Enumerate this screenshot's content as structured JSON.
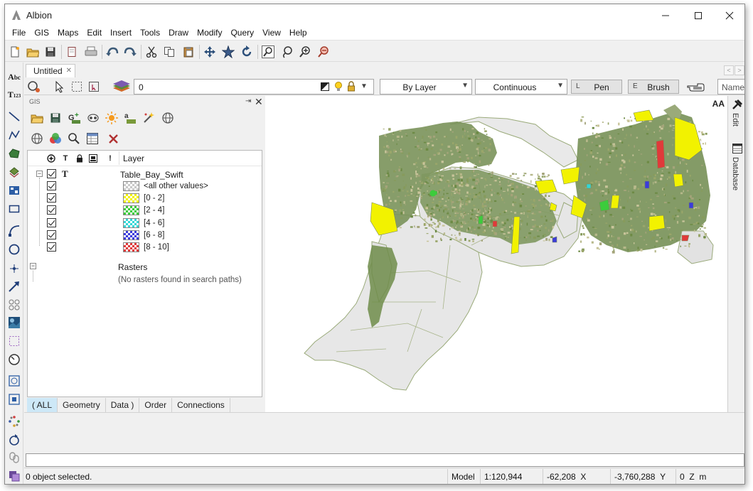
{
  "window": {
    "title": "Albion"
  },
  "menu": [
    "File",
    "GIS",
    "Maps",
    "Edit",
    "Insert",
    "Tools",
    "Draw",
    "Modify",
    "Query",
    "View",
    "Help"
  ],
  "document_tab": {
    "label": "Untitled"
  },
  "style_toolbar": {
    "layer_value": "0",
    "linetype_by": "By Layer",
    "linestyle": "Continuous",
    "pen": {
      "key": "L",
      "label": "Pen"
    },
    "brush": {
      "key": "E",
      "label": "Brush"
    },
    "named": "Named"
  },
  "gis_panel": {
    "title": "GIS",
    "header": {
      "layer": "Layer",
      "text_col": "T",
      "warn_col": "!"
    },
    "table": {
      "name": "Table_Bay_Swift",
      "type_glyph": "T"
    },
    "legend": [
      {
        "label": "<all other values>",
        "color": "#c8c8c8"
      },
      {
        "label": "[0 - 2]",
        "color": "#f2f200"
      },
      {
        "label": "[2 - 4]",
        "color": "#3ccc3c"
      },
      {
        "label": "[4 - 6]",
        "color": "#33d6d6"
      },
      {
        "label": "[6 - 8]",
        "color": "#3b3bdb"
      },
      {
        "label": "[8 - 10]",
        "color": "#e03a3a"
      }
    ],
    "rasters": {
      "label": "Rasters",
      "note": "(No rasters found in search paths)"
    },
    "tabs": [
      "( ALL",
      "Geometry",
      "Data )",
      "Order",
      "Connections"
    ]
  },
  "map": {
    "font_toggle": "AA"
  },
  "right_dock": {
    "edit": "Edit",
    "database": "Database"
  },
  "status": {
    "selection": "0 object selected.",
    "space": "Model",
    "scale": "1:120,944",
    "x_value": "-62,208",
    "x_axis": "X",
    "y_value": "-3,760,288",
    "y_axis": "Y",
    "z_value": "0",
    "z_axis": "Z",
    "unit": "m"
  },
  "icons": {
    "toolbar": [
      "new-icon",
      "open-folder-icon",
      "save-icon",
      "print-preview-icon",
      "print-icon",
      "undo-icon",
      "redo-icon",
      "cut-icon",
      "copy-icon",
      "paste-icon",
      "pan-icon",
      "star-icon",
      "refresh-icon",
      "zoom-window-icon",
      "lasso-icon",
      "zoom-in-icon",
      "zoom-out-icon"
    ],
    "left": [
      "text-icon",
      "attribute-text-icon",
      "line-icon",
      "polyline-icon",
      "polygon-icon",
      "layers-icon",
      "block-icon",
      "rectangle-icon",
      "arc-icon",
      "circle-icon",
      "point-icon",
      "arrow-icon",
      "pattern-icon",
      "image-icon",
      "selection-icon",
      "gauge-icon",
      "group-icon",
      "explode-icon",
      "points-icon",
      "rotate-icon",
      "link-icon",
      "layers-copy-icon"
    ]
  }
}
